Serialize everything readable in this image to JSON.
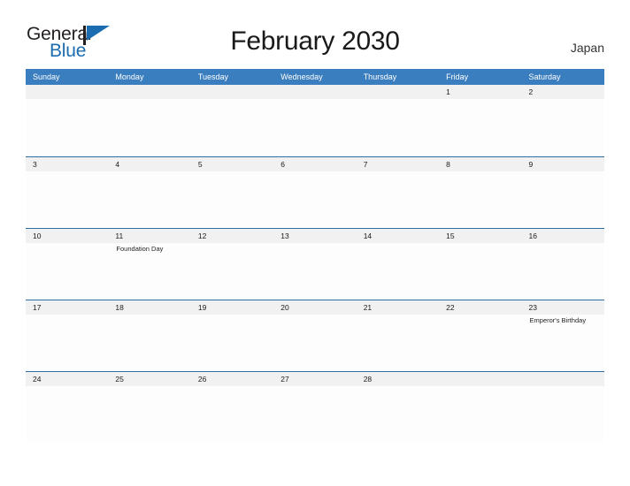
{
  "logo": {
    "word_one": "General",
    "word_two": "Blue",
    "flag_icon": "blue-flag-triangle",
    "brand_blue": "#1b6cb0"
  },
  "header": {
    "title": "February 2030",
    "country": "Japan"
  },
  "theme": {
    "header_blue": "#3b7ebf",
    "row_line_blue": "#2e6da4",
    "date_band_gray": "#f1f1f1"
  },
  "calendar": {
    "weekdays": [
      "Sunday",
      "Monday",
      "Tuesday",
      "Wednesday",
      "Thursday",
      "Friday",
      "Saturday"
    ],
    "weeks": [
      [
        {
          "date": ""
        },
        {
          "date": ""
        },
        {
          "date": ""
        },
        {
          "date": ""
        },
        {
          "date": ""
        },
        {
          "date": "1"
        },
        {
          "date": "2"
        }
      ],
      [
        {
          "date": "3"
        },
        {
          "date": "4"
        },
        {
          "date": "5"
        },
        {
          "date": "6"
        },
        {
          "date": "7"
        },
        {
          "date": "8"
        },
        {
          "date": "9"
        }
      ],
      [
        {
          "date": "10"
        },
        {
          "date": "11",
          "event": "Foundation Day"
        },
        {
          "date": "12"
        },
        {
          "date": "13"
        },
        {
          "date": "14"
        },
        {
          "date": "15"
        },
        {
          "date": "16"
        }
      ],
      [
        {
          "date": "17"
        },
        {
          "date": "18"
        },
        {
          "date": "19"
        },
        {
          "date": "20"
        },
        {
          "date": "21"
        },
        {
          "date": "22"
        },
        {
          "date": "23",
          "event": "Emperor's Birthday"
        }
      ],
      [
        {
          "date": "24"
        },
        {
          "date": "25"
        },
        {
          "date": "26"
        },
        {
          "date": "27"
        },
        {
          "date": "28"
        },
        {
          "date": ""
        },
        {
          "date": ""
        }
      ]
    ]
  }
}
